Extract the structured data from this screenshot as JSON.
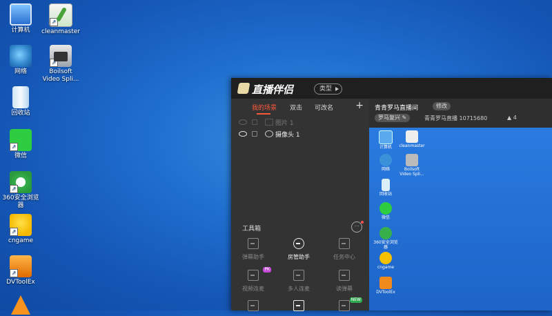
{
  "desktop": {
    "icons": [
      {
        "label": "计算机",
        "icon": "computer-icon"
      },
      {
        "label": "cleanmaster",
        "icon": "cleanmaster-icon"
      },
      {
        "label": "网络",
        "icon": "network-icon"
      },
      {
        "label": "Boilsoft Video Spli...",
        "icon": "boilsoft-icon"
      },
      {
        "label": "回收站",
        "icon": "recycle-bin-icon"
      },
      {
        "label": "微信",
        "icon": "wechat-icon"
      },
      {
        "label": "360安全浏览器",
        "icon": "360-browser-icon"
      },
      {
        "label": "cngame",
        "icon": "cngame-icon"
      },
      {
        "label": "DVToolEx",
        "icon": "dvtoolex-icon"
      },
      {
        "label": "",
        "icon": "vlc-icon"
      }
    ]
  },
  "app": {
    "title": "直播伴侣",
    "type_button": "类型",
    "tabs": [
      "我的场景",
      "双击",
      "可改名"
    ],
    "add_symbol": "+",
    "scenes": [
      {
        "name": "图片 1",
        "enabled": false
      },
      {
        "name": "摄像头 1",
        "enabled": true
      }
    ],
    "toolbox": {
      "title": "工具箱",
      "more_symbol": "⋯",
      "tools": [
        {
          "label": "弹幕助手",
          "enabled": false,
          "badge": ""
        },
        {
          "label": "房管助手",
          "enabled": true,
          "badge": ""
        },
        {
          "label": "任务中心",
          "enabled": false,
          "badge": ""
        },
        {
          "label": "视频连麦",
          "enabled": false,
          "badge": "PK"
        },
        {
          "label": "多人连麦",
          "enabled": false,
          "badge": ""
        },
        {
          "label": "读弹幕",
          "enabled": false,
          "badge": ""
        },
        {
          "label": "",
          "enabled": false,
          "badge": ""
        },
        {
          "label": "",
          "enabled": true,
          "badge": ""
        },
        {
          "label": "",
          "enabled": false,
          "badge": "NEW"
        }
      ]
    },
    "room": {
      "title": "青青罗马直播间",
      "edit_label": "修改",
      "category": "罗马复兴",
      "host_and_id": "青青罗马直播 10715680",
      "fans": "4"
    },
    "preview_icons": [
      "计算机",
      "cleanmaster",
      "网络",
      "Boilsoft Video Spli...",
      "回收站",
      "微信",
      "360安全浏览器",
      "cngame",
      "DVToolEx"
    ]
  },
  "colors": {
    "accent": "#ff5a3c",
    "panel": "#2b2b2b",
    "desktop": "#1f6fd0"
  }
}
